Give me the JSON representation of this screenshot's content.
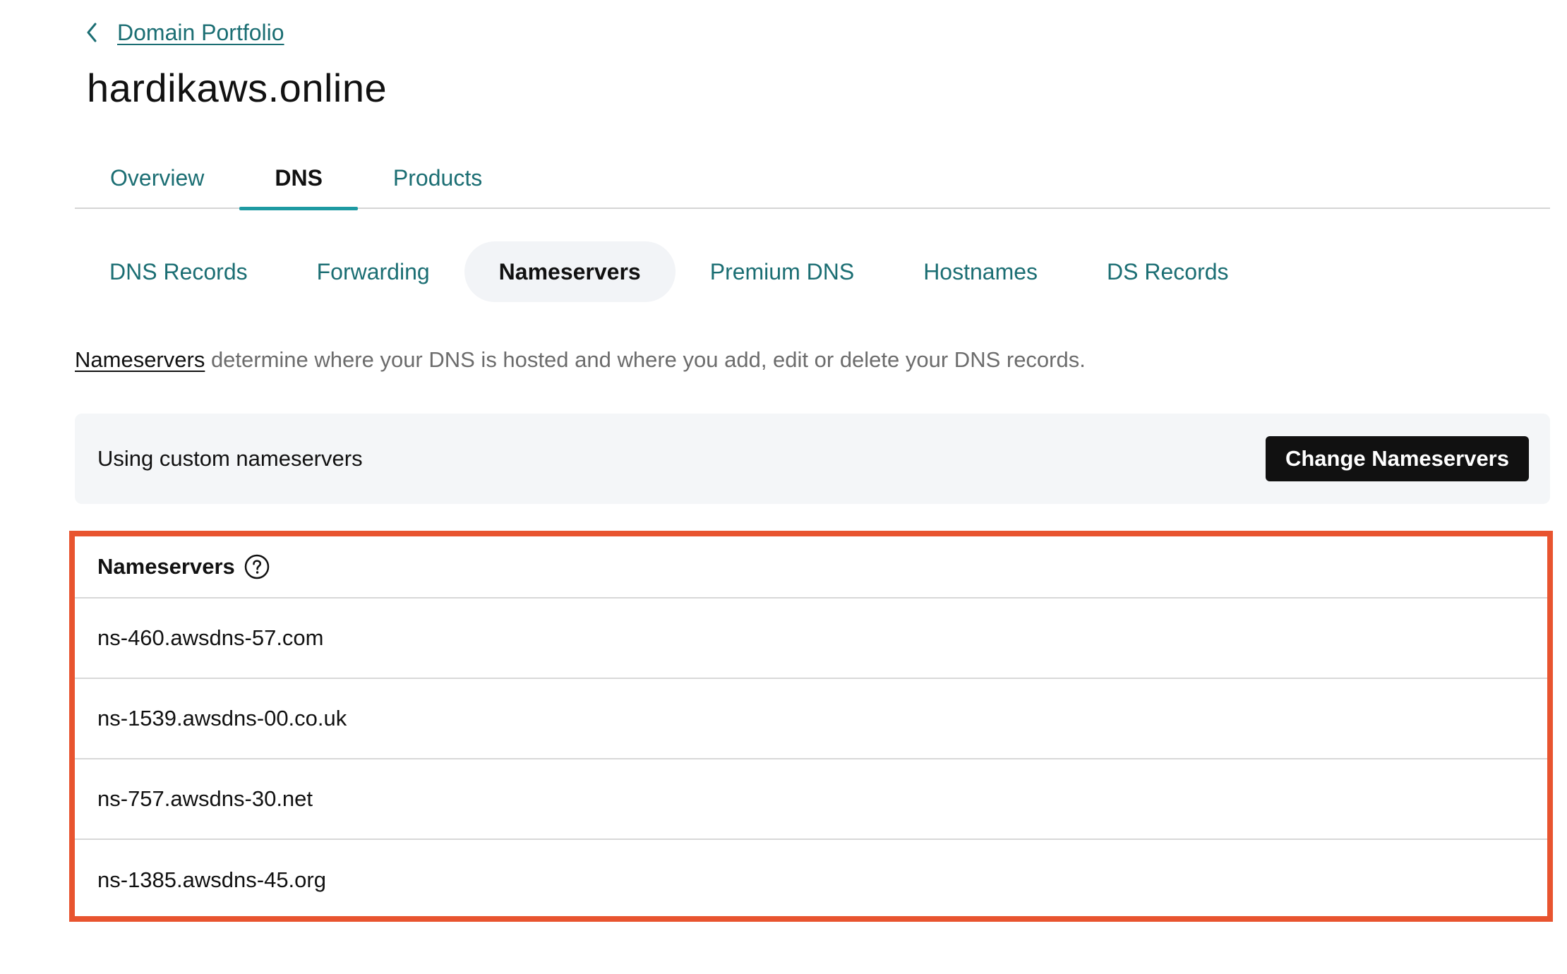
{
  "breadcrumb": {
    "back_icon": "chevron-left-icon",
    "label": "Domain Portfolio"
  },
  "page": {
    "title": "hardikaws.online"
  },
  "primary_tabs": [
    {
      "label": "Overview",
      "active": false
    },
    {
      "label": "DNS",
      "active": true
    },
    {
      "label": "Products",
      "active": false
    }
  ],
  "sub_tabs": [
    {
      "label": "DNS Records",
      "active": false
    },
    {
      "label": "Forwarding",
      "active": false
    },
    {
      "label": "Nameservers",
      "active": true
    },
    {
      "label": "Premium DNS",
      "active": false
    },
    {
      "label": "Hostnames",
      "active": false
    },
    {
      "label": "DS Records",
      "active": false
    }
  ],
  "description": {
    "link": "Nameservers",
    "text": " determine where your DNS is hosted and where you add, edit or delete your DNS records."
  },
  "status": {
    "text": "Using custom nameservers",
    "button_label": "Change Nameservers"
  },
  "nameservers": {
    "header": "Nameservers",
    "help_icon": "question-circle-icon",
    "rows": [
      "ns-460.awsdns-57.com",
      "ns-1539.awsdns-00.co.uk",
      "ns-757.awsdns-30.net",
      "ns-1385.awsdns-45.org"
    ]
  },
  "colors": {
    "link_teal": "#1b6e73",
    "active_underline": "#1e9aa2",
    "highlight_frame": "#e8542f",
    "button_bg": "#111111",
    "banner_bg": "#f4f6f8"
  }
}
